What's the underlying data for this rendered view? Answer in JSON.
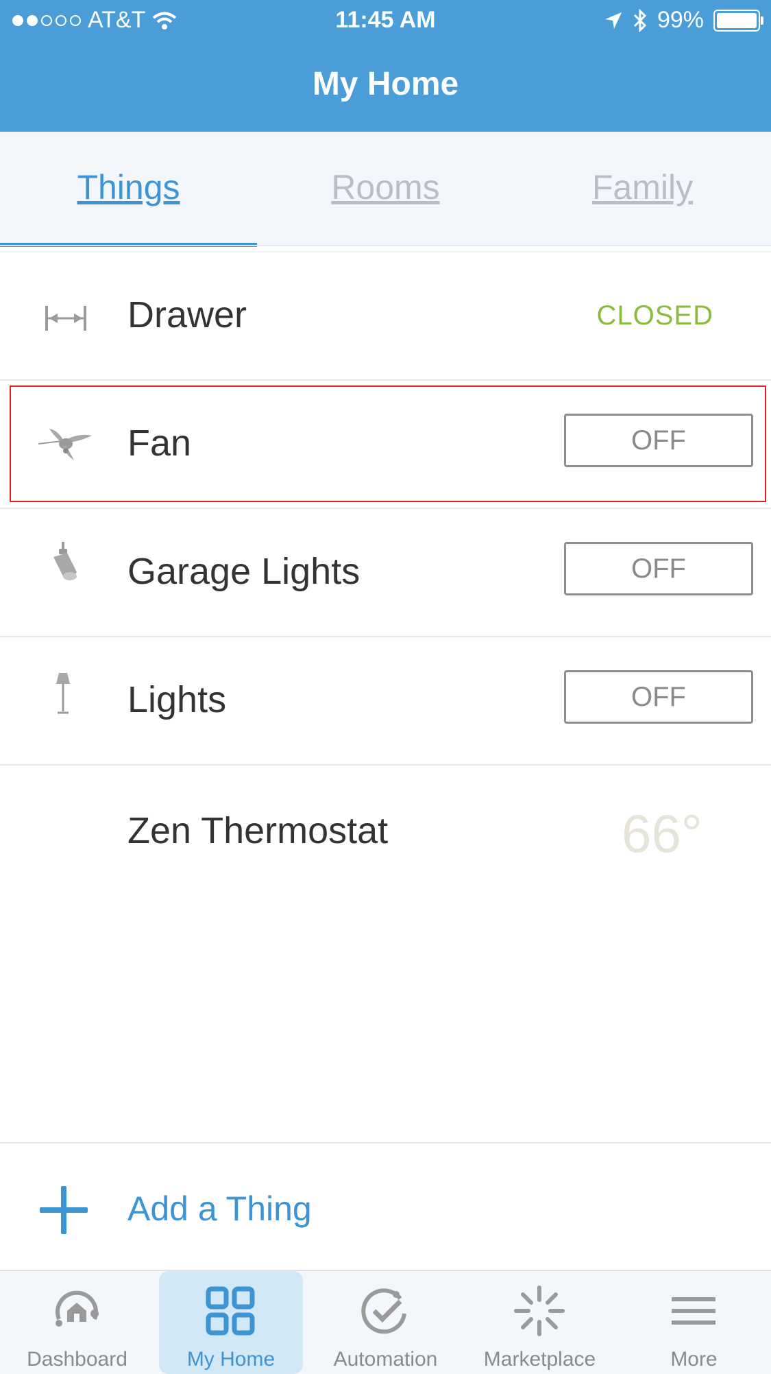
{
  "status_bar": {
    "carrier": "AT&T",
    "time": "11:45 AM",
    "battery": "99%"
  },
  "header": {
    "title": "My Home"
  },
  "tabs": [
    {
      "label": "Things",
      "active": true
    },
    {
      "label": "Rooms",
      "active": false
    },
    {
      "label": "Family",
      "active": false
    }
  ],
  "things": [
    {
      "name": "Drawer",
      "icon": "drawer-icon",
      "status": "CLOSED"
    },
    {
      "name": "Fan",
      "icon": "fan-icon",
      "toggle": "OFF"
    },
    {
      "name": "Garage Lights",
      "icon": "spotlight-icon",
      "toggle": "OFF"
    },
    {
      "name": "Lights",
      "icon": "floor-lamp-icon",
      "toggle": "OFF"
    },
    {
      "name": "Zen Thermostat",
      "temperature": "66°"
    }
  ],
  "add_thing": {
    "label": "Add a Thing"
  },
  "tab_bar": [
    {
      "label": "Dashboard",
      "icon": "dashboard-icon"
    },
    {
      "label": "My Home",
      "icon": "grid-icon",
      "active": true
    },
    {
      "label": "Automation",
      "icon": "check-circle-icon"
    },
    {
      "label": "Marketplace",
      "icon": "sparkle-icon"
    },
    {
      "label": "More",
      "icon": "menu-icon"
    }
  ],
  "colors": {
    "header": "#4a9dd6",
    "accent": "#3d94d4",
    "closed_status": "#8cba3c",
    "highlight": "#e02020"
  }
}
